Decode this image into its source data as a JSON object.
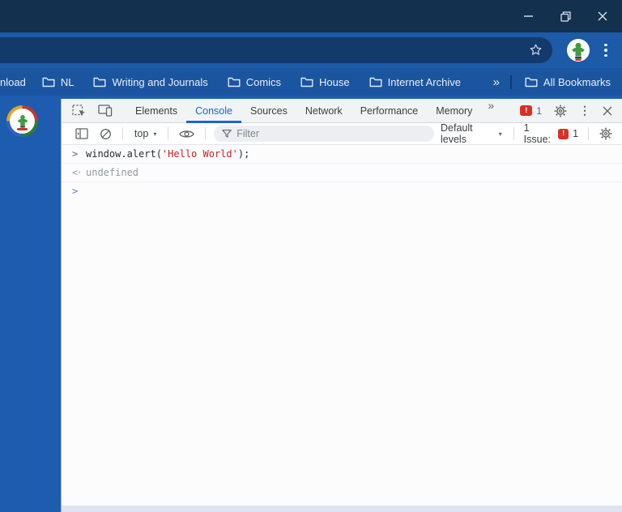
{
  "theme": {
    "titlebar": "#13304f",
    "toolbar": "#1d5aa7",
    "omnibox": "#123a6b",
    "bookmarks_bar": "#1b55a0",
    "page_bg": "#1e5cb0",
    "devtools_accent": "#1a66d0",
    "error_red": "#d93025",
    "string_red": "#c5221f"
  },
  "bookmarks_bar": {
    "items": [
      {
        "label": "nload"
      },
      {
        "label": "NL"
      },
      {
        "label": "Writing and Journals"
      },
      {
        "label": "Comics"
      },
      {
        "label": "House"
      },
      {
        "label": "Internet Archive"
      }
    ],
    "overflow_chevron": "»",
    "all_bookmarks_label": "All Bookmarks"
  },
  "devtools": {
    "tabs": {
      "elements": "Elements",
      "console": "Console",
      "sources": "Sources",
      "network": "Network",
      "performance": "Performance",
      "memory": "Memory",
      "more": "»"
    },
    "active_tab": "Console",
    "error_badge": {
      "glyph": "!",
      "count": "1"
    },
    "toolbar": {
      "context_label": "top",
      "caret": "▾",
      "filter_placeholder": "Filter",
      "levels_label": "Default levels",
      "issues_label": "1 Issue:",
      "issues_glyph": "!",
      "issues_count": "1"
    },
    "console": {
      "command_prompt": ">",
      "command_code": "window.alert(",
      "command_string": "'Hello World'",
      "command_end": ");",
      "result_arrow": "<·",
      "result_value": "undefined",
      "input_prompt": ">"
    }
  },
  "icons": {
    "window": [
      "minimize-icon",
      "restore-icon",
      "close-icon"
    ],
    "toolbar": [
      "star-icon",
      "profile-avatar",
      "kebab-menu-icon"
    ],
    "devtools": [
      "inspect-element-icon",
      "device-toolbar-icon",
      "settings-gear-icon",
      "sidebar-toggle-icon",
      "clear-console-icon",
      "eye-icon",
      "filter-funnel-icon"
    ]
  }
}
